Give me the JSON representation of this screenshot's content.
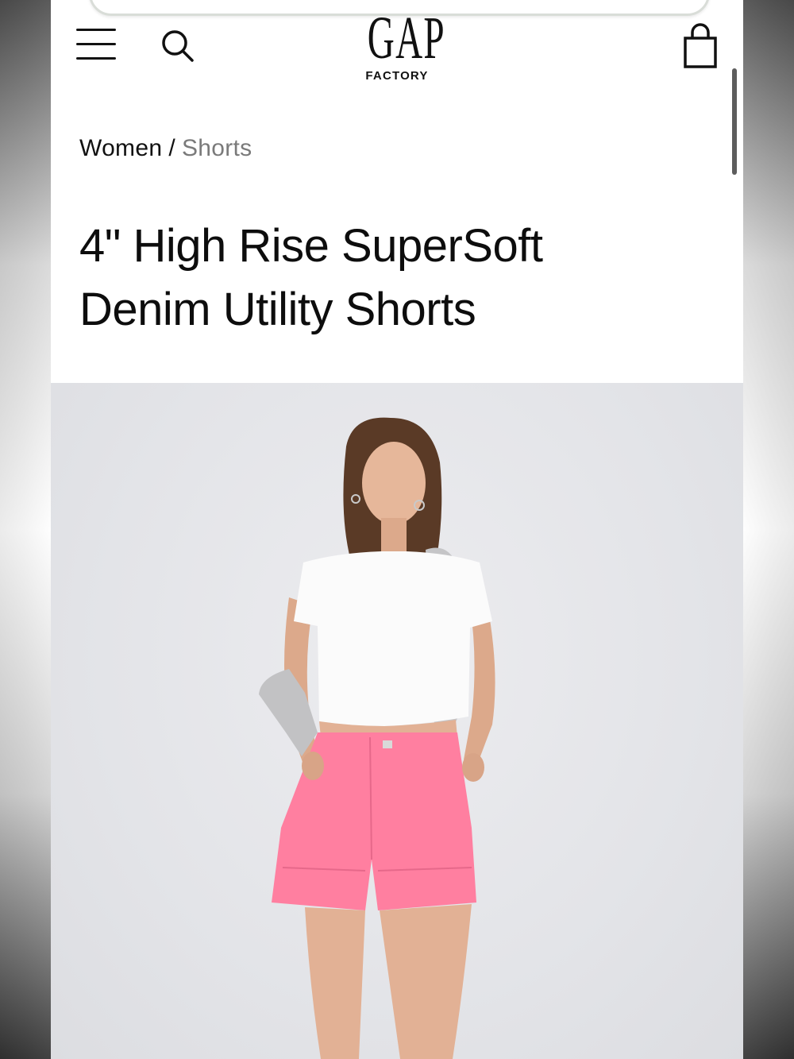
{
  "header": {
    "menu_icon": "hamburger-menu-icon",
    "search_icon": "search-icon",
    "logo_main": "GAP",
    "logo_sub": "FACTORY",
    "bag_icon": "shopping-bag-icon"
  },
  "breadcrumb": {
    "parent": "Women",
    "separator": "/",
    "current": "Shorts"
  },
  "product": {
    "title_line1": "4\" High Rise SuperSoft",
    "title_line2": "Denim Utility Shorts",
    "image_icon": "product-photo"
  },
  "colors": {
    "shorts_pink": "#ff7fa0",
    "background_image": "#e4e5e9",
    "breadcrumb_current": "#7a7a7a"
  }
}
